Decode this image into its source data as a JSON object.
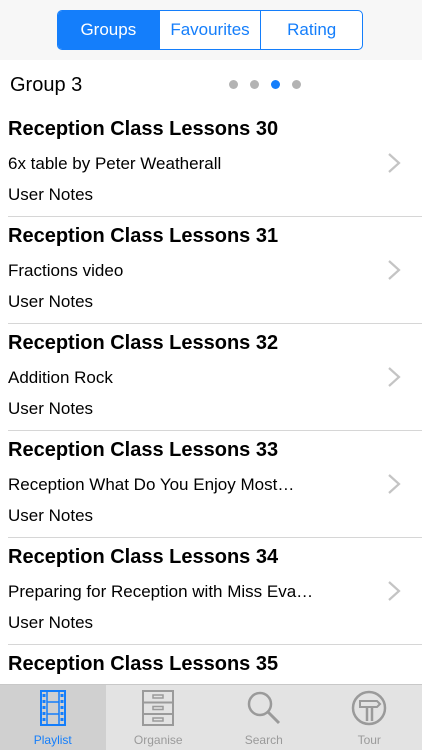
{
  "segments": [
    {
      "label": "Groups",
      "active": true
    },
    {
      "label": "Favourites",
      "active": false
    },
    {
      "label": "Rating",
      "active": false
    }
  ],
  "group": {
    "title": "Group 3",
    "page_index": 3,
    "page_count": 4
  },
  "items": [
    {
      "title": "Reception Class Lessons 30",
      "subtitle": "6x table by Peter Weatherall",
      "notes": "User Notes"
    },
    {
      "title": "Reception Class Lessons 31",
      "subtitle": "Fractions video",
      "notes": "User Notes"
    },
    {
      "title": "Reception Class Lessons 32",
      "subtitle": "Addition Rock",
      "notes": "User Notes"
    },
    {
      "title": "Reception Class Lessons 33",
      "subtitle": "Reception  What Do You Enjoy Most…",
      "notes": "User Notes"
    },
    {
      "title": "Reception Class Lessons 34",
      "subtitle": "Preparing for Reception with Miss Eva…",
      "notes": "User Notes"
    },
    {
      "title": "Reception Class Lessons 35",
      "subtitle": "",
      "notes": ""
    }
  ],
  "tabs": [
    {
      "label": "Playlist",
      "icon": "film-strip-icon",
      "active": true
    },
    {
      "label": "Organise",
      "icon": "filing-cabinet-icon",
      "active": false
    },
    {
      "label": "Search",
      "icon": "magnifier-icon",
      "active": false
    },
    {
      "label": "Tour",
      "icon": "signpost-icon",
      "active": false
    }
  ],
  "colors": {
    "accent": "#147efb",
    "tabbar": "#e3e3e3",
    "inactive": "#9a9a9a"
  }
}
